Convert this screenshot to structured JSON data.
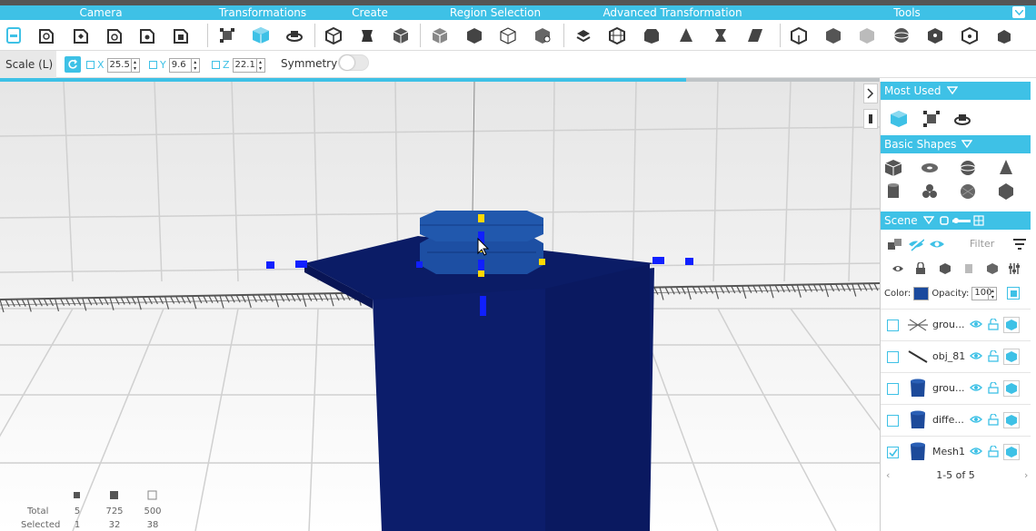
{
  "toolbar": {
    "sections": [
      "Camera",
      "Transformations",
      "Create",
      "Region Selection",
      "Advanced Transformation",
      "Tools"
    ]
  },
  "options": {
    "mode": "Scale (L)",
    "x_label": "X",
    "x_value": "25.5",
    "y_label": "Y",
    "y_value": "9.6",
    "z_label": "Z",
    "z_value": "22.1",
    "symmetry_label": "Symmetry",
    "symmetry_on": false,
    "load_progress": 0.78
  },
  "panel": {
    "most_used": "Most Used",
    "basic_shapes": "Basic Shapes",
    "scene": "Scene",
    "filter_placeholder": "Filter",
    "color_label": "Color:",
    "opacity_label": "Opacity:",
    "opacity_value": "100",
    "items": [
      {
        "label": "grou...",
        "checked": false,
        "thumb": "lines-icon"
      },
      {
        "label": "obj_81",
        "checked": false,
        "thumb": "line-icon"
      },
      {
        "label": "grou...",
        "checked": false,
        "thumb": "cylinder-icon"
      },
      {
        "label": "diffe...",
        "checked": false,
        "thumb": "cylinder-icon"
      },
      {
        "label": "Mesh1",
        "checked": true,
        "thumb": "cylinder-icon"
      }
    ],
    "pager": "1-5 of 5"
  },
  "stats": {
    "total_label": "Total",
    "selected_label": "Selected",
    "total": [
      "5",
      "725",
      "500"
    ],
    "selected": [
      "1",
      "32",
      "38"
    ]
  },
  "colors": {
    "accent": "#3ec1e6",
    "object": "#0d1f6e"
  }
}
